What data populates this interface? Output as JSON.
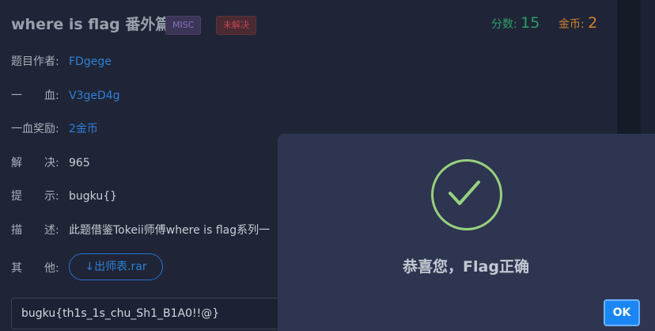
{
  "header": {
    "title": "where is flag 番外篇",
    "category_tag": "MISC",
    "status_tag": "未解决",
    "points_label": "分数:",
    "points_value": "15",
    "coins_label": "金币:",
    "coins_value": "2"
  },
  "details": [
    {
      "label": "题目作者:",
      "value": "FDgege"
    },
    {
      "label": "一　　血:",
      "value": "V3geD4g"
    },
    {
      "label": "一血奖励:",
      "value": "2金币"
    },
    {
      "label": "解　　决:",
      "value": "965"
    },
    {
      "label": "提　　示:",
      "value": "bugku{}"
    },
    {
      "label": "描　　述:",
      "value": "此题借鉴Tokeii师傅where is flag系列一"
    },
    {
      "label": "其　　他:",
      "value": ""
    }
  ],
  "attachment": {
    "label": "↓出师表.rar"
  },
  "flag_input": {
    "value": "bugku{th1s_1s_chu_Sh1_B1A0!!@}"
  },
  "modal": {
    "message": "恭喜您，Flag正确",
    "ok_label": "OK",
    "icon": "check-circle-icon"
  },
  "colors": {
    "background": "#1f2536",
    "modal": "#2e3550",
    "success": "#98d07f",
    "link": "#2f7fd6",
    "points": "#2d9e6b",
    "coins": "#d1822f",
    "ok_button": "#1a86f4"
  }
}
